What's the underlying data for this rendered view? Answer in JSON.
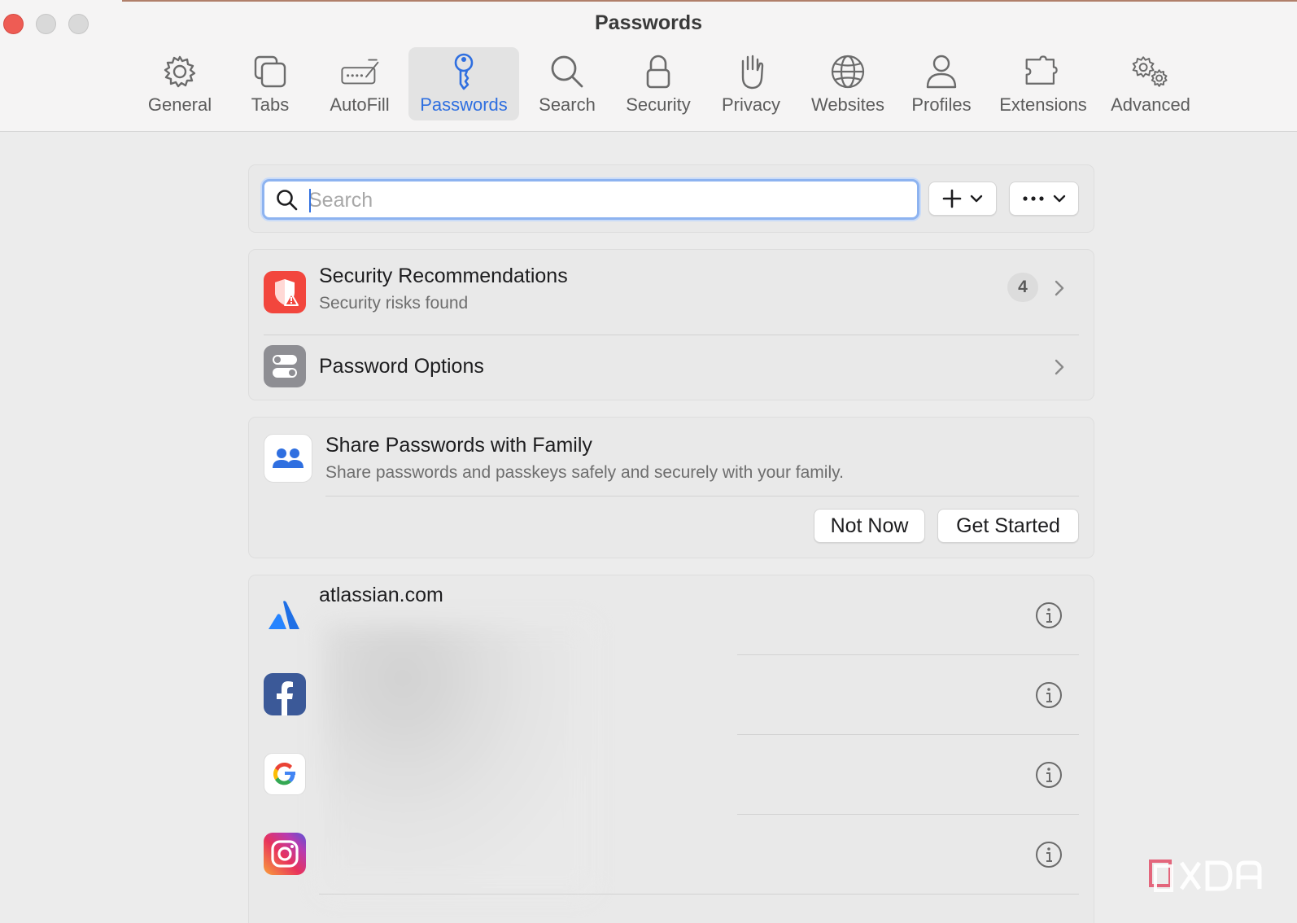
{
  "window": {
    "title": "Passwords"
  },
  "toolbar": {
    "tabs": [
      {
        "id": "general",
        "label": "General",
        "icon": "gear-icon"
      },
      {
        "id": "tabs",
        "label": "Tabs",
        "icon": "tabs-icon"
      },
      {
        "id": "autofill",
        "label": "AutoFill",
        "icon": "autofill-pencil-icon"
      },
      {
        "id": "passwords",
        "label": "Passwords",
        "icon": "key-icon",
        "active": true
      },
      {
        "id": "search",
        "label": "Search",
        "icon": "magnifier-icon"
      },
      {
        "id": "security",
        "label": "Security",
        "icon": "lock-icon"
      },
      {
        "id": "privacy",
        "label": "Privacy",
        "icon": "hand-icon"
      },
      {
        "id": "websites",
        "label": "Websites",
        "icon": "globe-icon"
      },
      {
        "id": "profiles",
        "label": "Profiles",
        "icon": "person-icon"
      },
      {
        "id": "extensions",
        "label": "Extensions",
        "icon": "puzzle-icon"
      },
      {
        "id": "advanced",
        "label": "Advanced",
        "icon": "gears-icon"
      }
    ]
  },
  "search": {
    "placeholder": "Search",
    "value": ""
  },
  "actions": {
    "add_icon": "plus-icon",
    "more_icon": "ellipsis-icon"
  },
  "recommendations": {
    "title": "Security Recommendations",
    "subtitle": "Security risks found",
    "count": "4"
  },
  "password_options": {
    "title": "Password Options"
  },
  "share": {
    "title": "Share Passwords with Family",
    "subtitle": "Share passwords and passkeys safely and securely with your family.",
    "not_now": "Not Now",
    "get_started": "Get Started"
  },
  "accounts": [
    {
      "site": "atlassian.com",
      "icon": "atlassian-icon"
    },
    {
      "site": "",
      "icon": "facebook-icon"
    },
    {
      "site": "",
      "icon": "google-icon"
    },
    {
      "site": "",
      "icon": "instagram-icon"
    }
  ],
  "colors": {
    "accent": "#2f6fe0",
    "close_button": "#ee5c54",
    "security_red": "#f2463d",
    "watermark": "XDA"
  }
}
